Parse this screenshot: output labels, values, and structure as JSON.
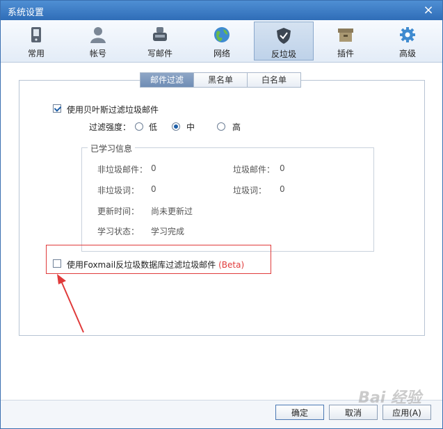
{
  "window": {
    "title": "系统设置",
    "close": "×"
  },
  "toolbar": [
    {
      "label": "常用",
      "icon": "phone-icon"
    },
    {
      "label": "帐号",
      "icon": "user-icon"
    },
    {
      "label": "写邮件",
      "icon": "compose-icon"
    },
    {
      "label": "网络",
      "icon": "globe-icon"
    },
    {
      "label": "反垃圾",
      "icon": "shield-icon",
      "active": true
    },
    {
      "label": "插件",
      "icon": "box-icon"
    },
    {
      "label": "高级",
      "icon": "gear-icon"
    }
  ],
  "tabs": [
    {
      "label": "邮件过滤",
      "active": true
    },
    {
      "label": "黑名单"
    },
    {
      "label": "白名单"
    }
  ],
  "bayes": {
    "label": "使用贝叶斯过滤垃圾邮件",
    "checked": true
  },
  "strength": {
    "label": "过滤强度：",
    "low": "低",
    "mid": "中",
    "high": "高",
    "selected": "中"
  },
  "learned": {
    "title": "已学习信息",
    "nonspam_mail_label": "非垃圾邮件：",
    "nonspam_mail_value": "0",
    "spam_mail_label": "垃圾邮件：",
    "spam_mail_value": "0",
    "nonspam_word_label": "非垃圾词：",
    "nonspam_word_value": "0",
    "spam_word_label": "垃圾词：",
    "spam_word_value": "0",
    "update_label": "更新时间：",
    "update_value": "尚未更新过",
    "status_label": "学习状态：",
    "status_value": "学习完成"
  },
  "foxmail": {
    "label": "使用Foxmail反垃圾数据库过滤垃圾邮件",
    "beta": "(Beta)",
    "checked": false
  },
  "buttons": {
    "ok": "确定",
    "cancel": "取消",
    "apply": "应用(A)"
  },
  "watermark": "Bai 经验",
  "colors": {
    "accent": "#2f6db7",
    "highlight": "#e03a3a"
  }
}
